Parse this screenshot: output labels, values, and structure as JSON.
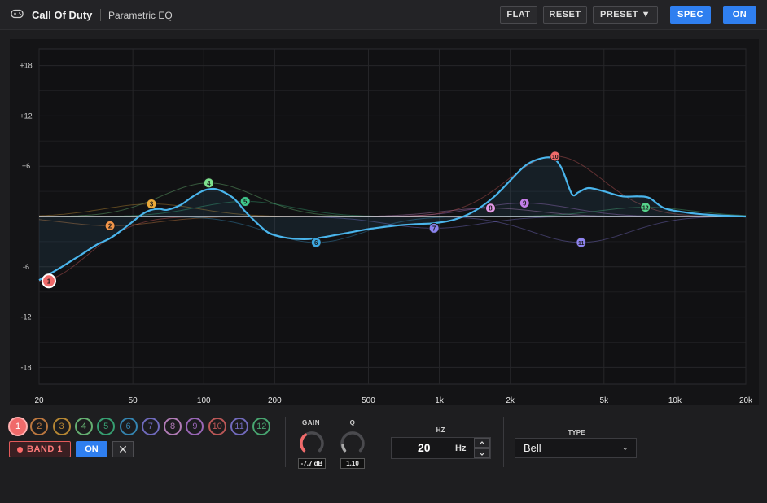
{
  "header": {
    "app_title": "Call Of Duty",
    "subtitle": "Parametric EQ",
    "buttons": {
      "flat": "FLAT",
      "reset": "RESET",
      "preset": "PRESET ▼",
      "spec": "SPEC",
      "on": "ON"
    }
  },
  "graph": {
    "y_labels": [
      "+18",
      "+12",
      "+6",
      "-6",
      "-12",
      "-18"
    ],
    "x_labels": [
      "20",
      "50",
      "100",
      "200",
      "500",
      "1k",
      "2k",
      "5k",
      "10k",
      "20k"
    ],
    "y_range_db": [
      -20,
      20
    ],
    "x_range_hz": [
      20,
      20000
    ],
    "curve_color": "#4ab5ec"
  },
  "bands": [
    {
      "label": "1",
      "freq": 20,
      "gain": -7.7,
      "color": "#f06a6a"
    },
    {
      "label": "2",
      "freq": 40,
      "gain": -1.1,
      "color": "#f0954a"
    },
    {
      "label": "3",
      "freq": 60,
      "gain": 1.5,
      "color": "#e8a93a"
    },
    {
      "label": "4",
      "freq": 105,
      "gain": 4.0,
      "color": "#7de08d"
    },
    {
      "label": "5",
      "freq": 150,
      "gain": 1.8,
      "color": "#3ec98c"
    },
    {
      "label": "6",
      "freq": 300,
      "gain": -3.1,
      "color": "#3ca7e0"
    },
    {
      "label": "7",
      "freq": 950,
      "gain": -1.4,
      "color": "#8b84f0"
    },
    {
      "label": "8",
      "freq": 1650,
      "gain": 1.0,
      "color": "#e29ae8"
    },
    {
      "label": "9",
      "freq": 2300,
      "gain": 1.6,
      "color": "#c27ee8"
    },
    {
      "label": "10",
      "freq": 3100,
      "gain": 7.2,
      "color": "#f06a6a"
    },
    {
      "label": "11",
      "freq": 4000,
      "gain": -3.1,
      "color": "#8f84f0"
    },
    {
      "label": "12",
      "freq": 7500,
      "gain": 1.1,
      "color": "#56d28b"
    }
  ],
  "curve_points": [
    [
      20,
      -7.6
    ],
    [
      25,
      -6.0
    ],
    [
      30,
      -4.6
    ],
    [
      35,
      -3.4
    ],
    [
      40,
      -2.6
    ],
    [
      45,
      -1.6
    ],
    [
      50,
      -0.6
    ],
    [
      55,
      0.3
    ],
    [
      60,
      0.8
    ],
    [
      65,
      0.9
    ],
    [
      70,
      0.8
    ],
    [
      80,
      1.4
    ],
    [
      90,
      2.4
    ],
    [
      100,
      3.1
    ],
    [
      110,
      3.3
    ],
    [
      120,
      3.0
    ],
    [
      135,
      2.1
    ],
    [
      150,
      0.6
    ],
    [
      170,
      -0.9
    ],
    [
      190,
      -2.0
    ],
    [
      220,
      -2.5
    ],
    [
      260,
      -2.7
    ],
    [
      300,
      -2.6
    ],
    [
      400,
      -2.0
    ],
    [
      500,
      -1.5
    ],
    [
      650,
      -1.1
    ],
    [
      800,
      -0.9
    ],
    [
      950,
      -0.8
    ],
    [
      1150,
      -0.4
    ],
    [
      1400,
      0.6
    ],
    [
      1700,
      2.3
    ],
    [
      2000,
      4.3
    ],
    [
      2300,
      6.0
    ],
    [
      2600,
      6.8
    ],
    [
      3000,
      7.0
    ],
    [
      3300,
      5.8
    ],
    [
      3650,
      2.7
    ],
    [
      3900,
      2.9
    ],
    [
      4300,
      3.4
    ],
    [
      5000,
      3.0
    ],
    [
      6000,
      2.4
    ],
    [
      7000,
      2.4
    ],
    [
      7800,
      2.2
    ],
    [
      9000,
      1.0
    ],
    [
      11000,
      0.5
    ],
    [
      14000,
      0.2
    ],
    [
      20000,
      0.0
    ]
  ],
  "band_row": {
    "buttons": [
      "1",
      "2",
      "3",
      "4",
      "5",
      "6",
      "7",
      "8",
      "9",
      "10",
      "11",
      "12"
    ]
  },
  "selected_band": {
    "label": "BAND 1",
    "on_label": "ON",
    "close_label": "✕",
    "gain_label": "GAIN",
    "gain_value": "-7.7 dB",
    "q_label": "Q",
    "q_value": "1.10",
    "hz_label": "HZ",
    "hz_value": "20",
    "hz_unit": "Hz",
    "type_label": "TYPE",
    "type_value": "Bell"
  }
}
